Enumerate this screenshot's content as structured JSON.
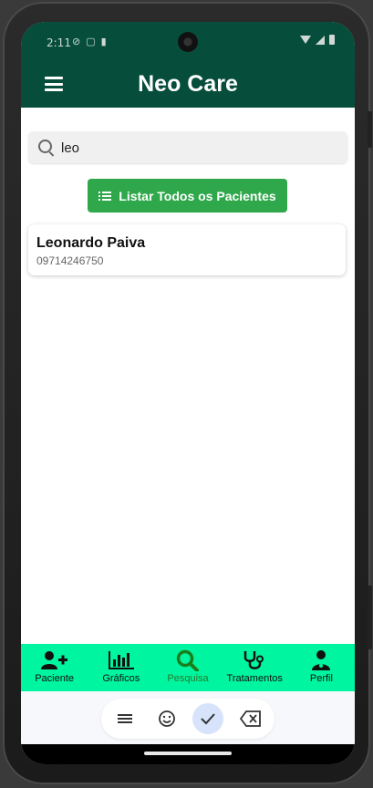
{
  "status_bar": {
    "time": "2:11"
  },
  "header": {
    "title": "Neo Care"
  },
  "search": {
    "value": "leo"
  },
  "actions": {
    "list_all_label": "Listar Todos os Pacientes"
  },
  "results": [
    {
      "name": "Leonardo Paiva",
      "phone": "09714246750"
    }
  ],
  "bottom_nav": {
    "items": [
      {
        "label": "Paciente",
        "icon": "user-plus-icon"
      },
      {
        "label": "Gráficos",
        "icon": "bar-chart-icon"
      },
      {
        "label": "Pesquisa",
        "icon": "search-icon",
        "active": true
      },
      {
        "label": "Tratamentos",
        "icon": "stethoscope-icon"
      },
      {
        "label": "Perfil",
        "icon": "doctor-icon"
      }
    ]
  },
  "colors": {
    "header_bg": "#064e3b",
    "button_green": "#2ea84b",
    "nav_bg": "#00f5a0",
    "active_nav": "#1a7f1a"
  }
}
